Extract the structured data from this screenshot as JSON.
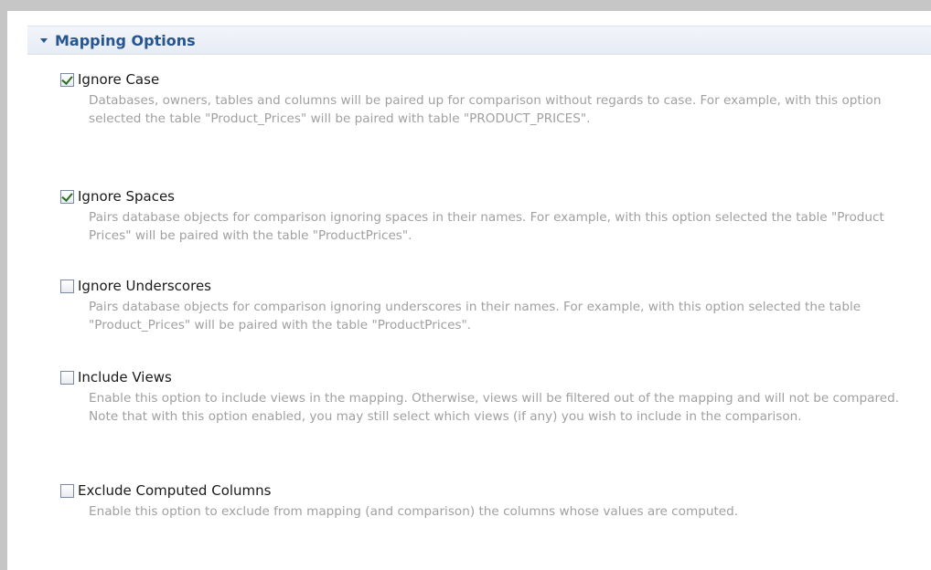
{
  "section": {
    "title": "Mapping Options",
    "expanded": true
  },
  "options": [
    {
      "label": "Ignore Case",
      "checked": true,
      "description": "Databases, owners, tables and columns will be paired up for comparison without regards to case. For example, with this option selected the table \"Product_Prices\" will be paired with table \"PRODUCT_PRICES\"."
    },
    {
      "label": "Ignore Spaces",
      "checked": true,
      "description": "Pairs database objects for comparison ignoring spaces in their names. For example, with this option selected the table \"Product Prices\" will be paired with the table \"ProductPrices\"."
    },
    {
      "label": "Ignore Underscores",
      "checked": false,
      "description": "Pairs database objects for comparison ignoring underscores in their names. For example, with this option selected the table \"Product_Prices\" will be paired with the table \"ProductPrices\"."
    },
    {
      "label": "Include Views",
      "checked": false,
      "description": "Enable this option to include views in the mapping. Otherwise, views will be filtered out of the mapping and will not be compared. Note that with this option enabled, you may still select which views (if any) you wish to include in the comparison."
    },
    {
      "label": "Exclude Computed Columns",
      "checked": false,
      "description": "Enable this option to exclude from mapping (and comparison) the columns whose values are computed."
    }
  ],
  "colors": {
    "header_text": "#27558f",
    "label_text": "#1a1a1a",
    "description_text": "#a0a0a0",
    "checkmark": "#2a6f1f"
  },
  "icons": {
    "section_toggle": "triangle-down-icon",
    "checked_box": "checkmark-icon"
  }
}
